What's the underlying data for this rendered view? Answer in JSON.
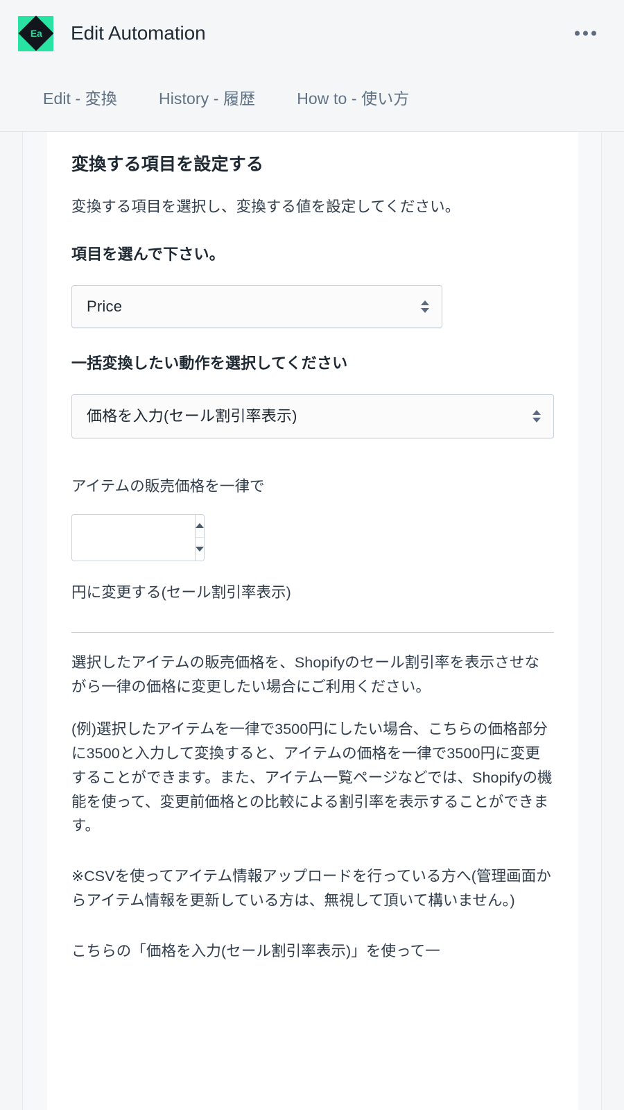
{
  "header": {
    "app_icon_label": "Ea",
    "title": "Edit Automation",
    "more_icon": "ellipsis-horizontal-icon"
  },
  "tabs": [
    {
      "label": "Edit - 変換",
      "active": true
    },
    {
      "label": "History - 履歴",
      "active": false
    },
    {
      "label": "How to - 使い方",
      "active": false
    }
  ],
  "main": {
    "section_title": "変換する項目を設定する",
    "section_description": "変換する項目を選択し、変換する値を設定してください。",
    "field_label": "項目を選んで下さい。",
    "field_select_value": "Price",
    "action_label": "一括変換したい動作を選択してください",
    "action_select_value": "価格を入力(セール割引率表示)",
    "price_prefix_label": "アイテムの販売価格を一律で",
    "price_input_value": "",
    "price_input_placeholder": "",
    "price_suffix_label": "円に変更する(セール割引率表示)",
    "help_paragraphs": [
      "選択したアイテムの販売価格を、Shopifyのセール割引率を表示させながら一律の価格に変更したい場合にご利用ください。",
      "(例)選択したアイテムを一律で3500円にしたい場合、こちらの価格部分に3500と入力して変換すると、アイテムの価格を一律で3500円に変更することができます。また、アイテム一覧ページなどでは、Shopifyの機能を使って、変更前価格との比較による割引率を表示することができます。",
      "※CSVを使ってアイテム情報アップロードを行っている方へ(管理画面からアイテム情報を更新している方は、無視して頂いて構いません。)",
      "こちらの「価格を入力(セール割引率表示)」を使って一"
    ]
  },
  "colors": {
    "page_background": "#f4f6f8",
    "card_background": "#ffffff",
    "brand_green": "#29e3a2",
    "text_primary": "#212b36",
    "text_muted": "#5f7183",
    "border": "#c8d2dd"
  }
}
